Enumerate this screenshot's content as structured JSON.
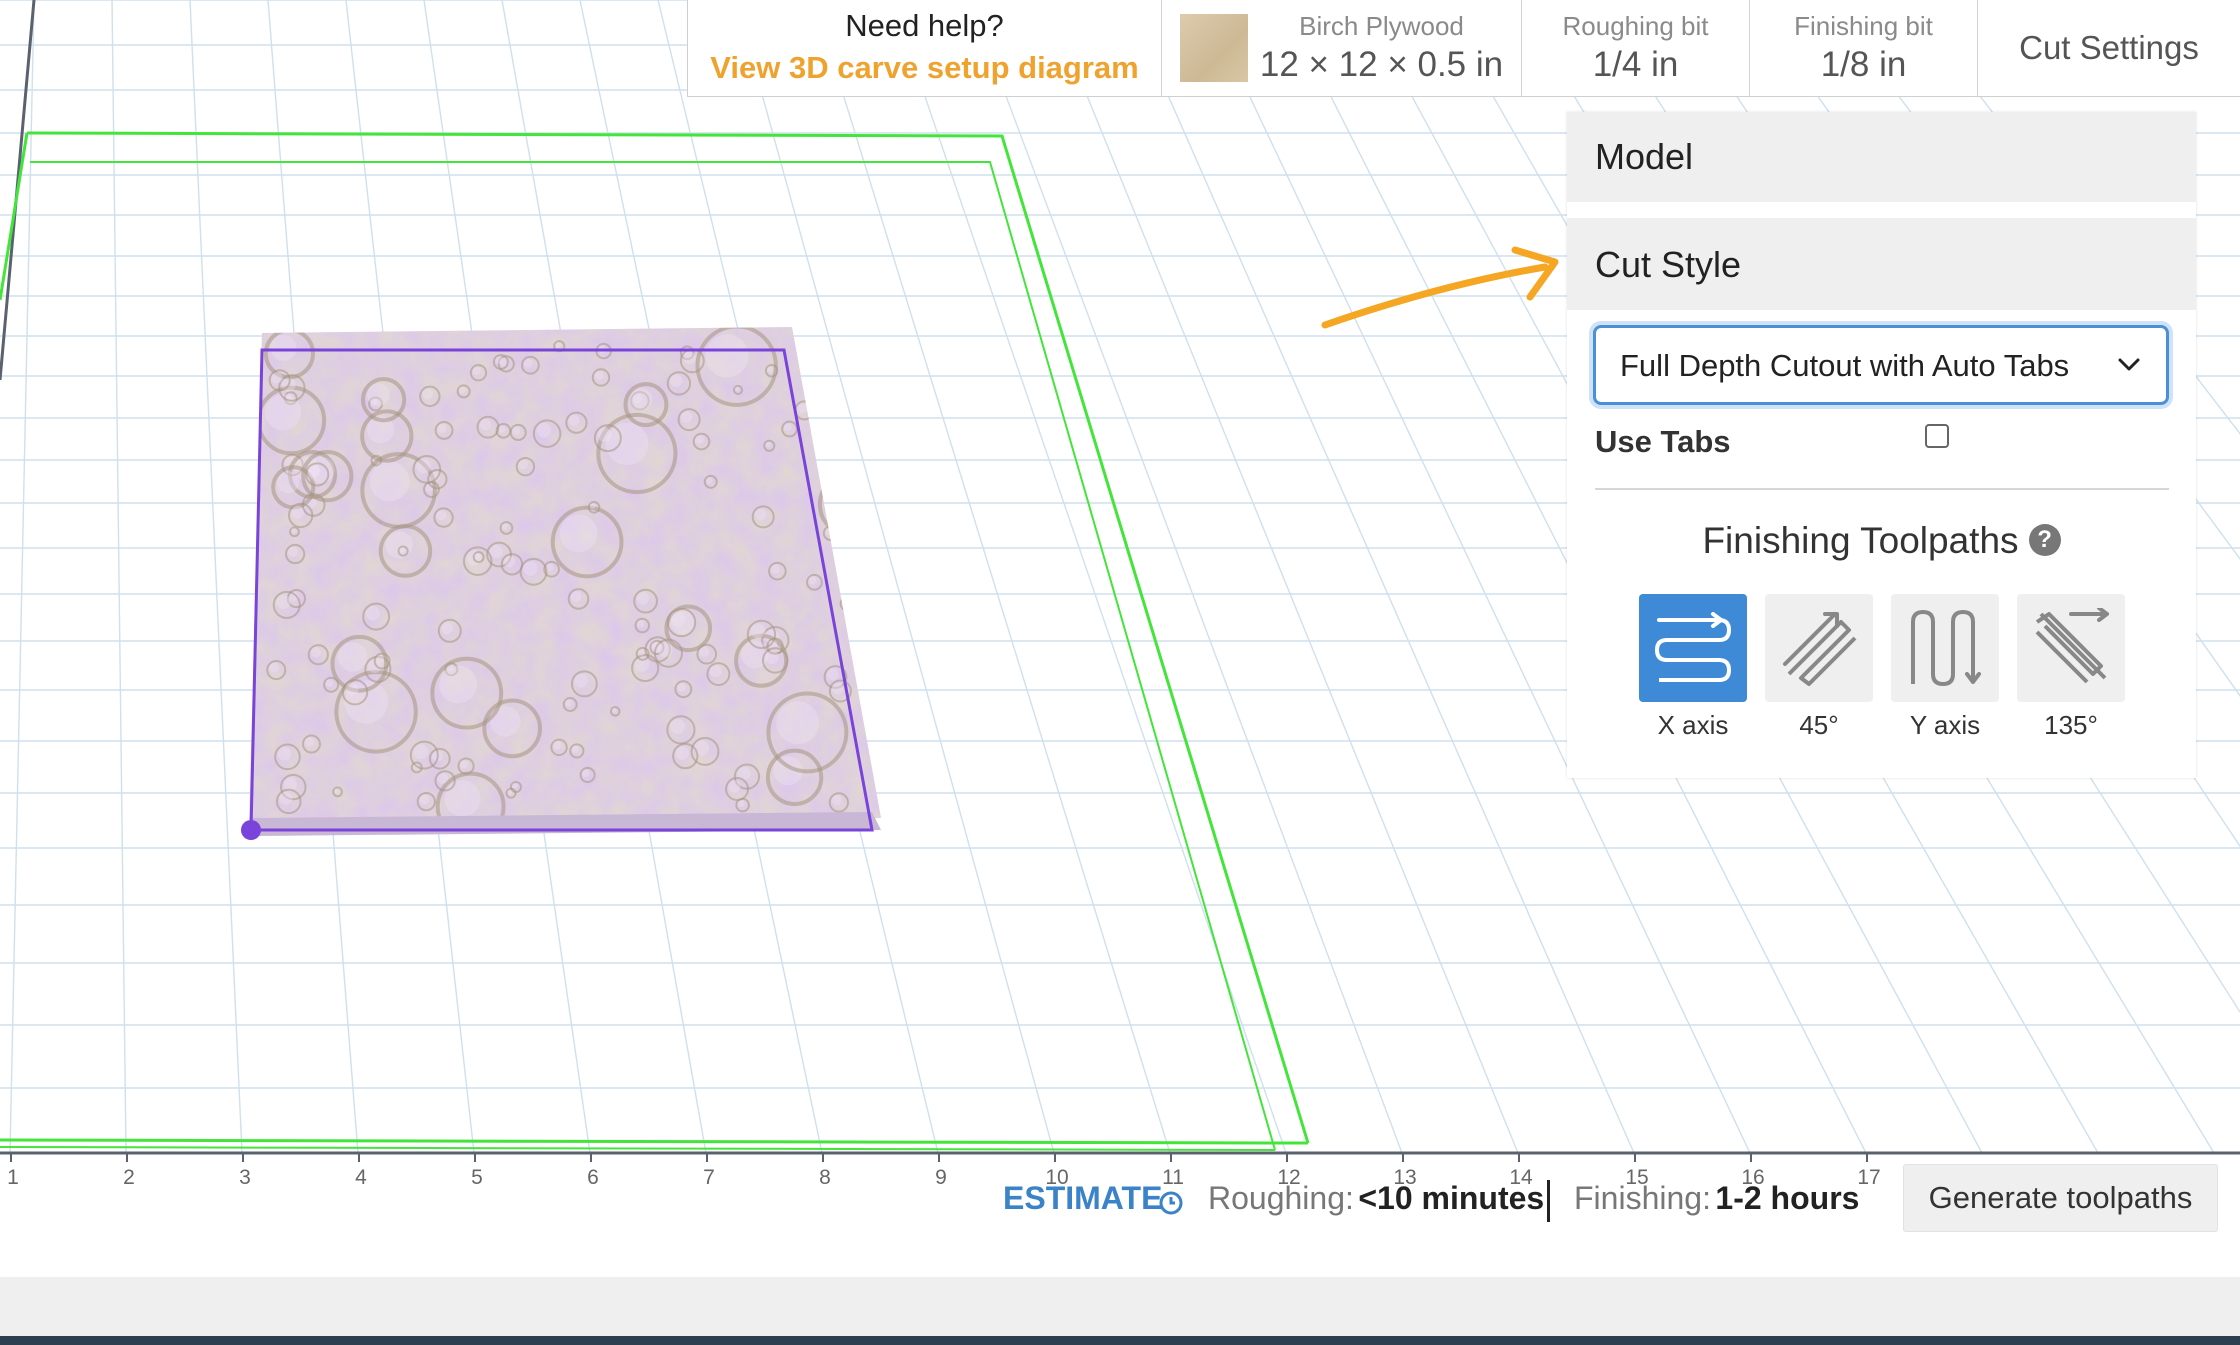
{
  "toolbar": {
    "help_title": "Need help?",
    "help_link": "View 3D carve setup diagram",
    "material_name": "Birch Plywood",
    "material_size": "12 × 12 × 0.5 in",
    "roughing_label": "Roughing bit",
    "roughing_value": "1/4 in",
    "finishing_label": "Finishing bit",
    "finishing_value": "1/8 in",
    "settings_label": "Cut Settings"
  },
  "panel": {
    "model_label": "Model",
    "cut_style_label": "Cut Style",
    "cut_style_value": "Full Depth Cutout with Auto Tabs",
    "use_tabs_label": "Use Tabs",
    "use_tabs_checked": false,
    "toolpaths_title": "Finishing Toolpaths",
    "toolpaths": [
      {
        "label": "X axis",
        "active": true
      },
      {
        "label": "45°",
        "active": false
      },
      {
        "label": "Y axis",
        "active": false
      },
      {
        "label": "135°",
        "active": false
      }
    ]
  },
  "ruler": {
    "x_ticks": [
      "1",
      "2",
      "3",
      "4",
      "5",
      "6",
      "7",
      "8",
      "9",
      "10",
      "11",
      "12",
      "13",
      "14",
      "15",
      "16",
      "17"
    ]
  },
  "estimate": {
    "label": "ESTIMATE",
    "roughing_key": "Roughing:",
    "roughing_value": "<10 minutes",
    "finishing_key": "Finishing:",
    "finishing_value": "1-2 hours"
  },
  "generate_label": "Generate toolpaths",
  "colors": {
    "accent_orange": "#f0a22e",
    "accent_blue": "#3b83c8",
    "active_toolpath": "#3f8ad6",
    "stock_outline": "#44e53a",
    "model_outline": "#7a43d9"
  }
}
